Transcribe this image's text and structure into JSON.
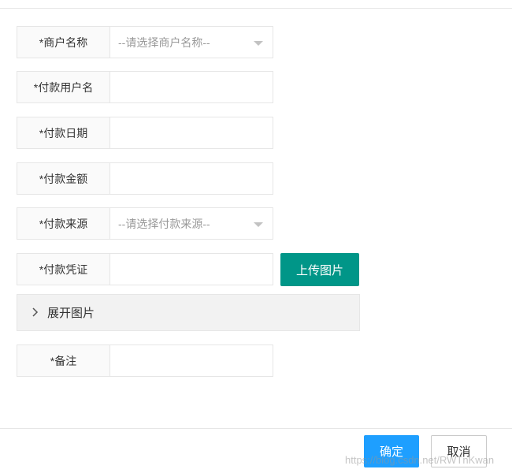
{
  "form": {
    "merchant": {
      "label": "*商户名称",
      "placeholder": "--请选择商户名称--"
    },
    "username": {
      "label": "*付款用户名",
      "value": ""
    },
    "date": {
      "label": "*付款日期",
      "value": ""
    },
    "amount": {
      "label": "*付款金额",
      "value": ""
    },
    "source": {
      "label": "*付款来源",
      "placeholder": "--请选择付款来源--"
    },
    "voucher": {
      "label": "*付款凭证",
      "value": "",
      "upload_label": "上传图片"
    },
    "collapse": {
      "label": "展开图片",
      "icon": "chevron-right-icon"
    },
    "remark": {
      "label": "*备注",
      "value": ""
    }
  },
  "footer": {
    "confirm_label": "确定",
    "cancel_label": "取消"
  },
  "watermark": "https://blog.csdn.net/RWTnKwan",
  "colors": {
    "upload_button": "#009688",
    "confirm_button": "#1e9fff",
    "border": "#e6e6e6",
    "collapse_bg": "#f2f2f2"
  }
}
